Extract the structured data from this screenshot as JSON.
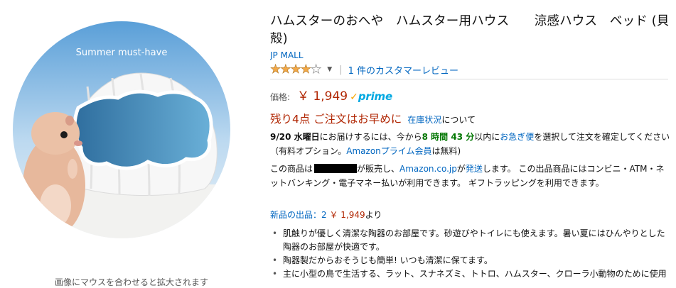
{
  "image": {
    "overlay_text": "Summer must-have",
    "hover_hint": "画像にマウスを合わせると拡大されます"
  },
  "product": {
    "title": "ハムスターのおへや　ハムスター用ハウス　　涼感ハウス　ベッド (貝殻)",
    "brand": "JP MALL",
    "rating": {
      "stars": 4,
      "max_stars": 5,
      "review_link": "1 件のカスタマーレビュー"
    },
    "price": {
      "label": "価格:",
      "amount": "￥ 1,949",
      "prime_check": "✓",
      "prime_text": "prime"
    },
    "stock": {
      "warning": "残り4点 ご注文はお早めに",
      "link": "在庫状況",
      "after": "について"
    },
    "delivery": {
      "date": "9/20 水曜日",
      "text1": "にお届けするには、今から",
      "countdown": "8 時間 43 分",
      "text2": "以内に",
      "express_link": "お急ぎ便",
      "text3": "を選択して注文を確定してください（有料オプション。",
      "prime_member_link": "Amazonプライム会員",
      "text4": "は無料)"
    },
    "seller": {
      "text1": "この商品は",
      "text2": "が販売し、",
      "amazon_link": "Amazon.co.jp",
      "text3": "が",
      "shipping_link": "発送",
      "text4": "します。 この出品商品にはコンビニ・ATM・ネットバンキング・電子マネー払いが利用できます。 ギフトラッピングを利用できます。"
    },
    "new_offers": {
      "link": "新品の出品：2",
      "price": "￥ 1,949",
      "suffix": "より"
    },
    "bullets": [
      "肌触りが優しく清潔な陶器のお部屋です。砂遊びやトイレにも使えます。暑い夏にはひんやりとした陶器のお部屋が快適です。",
      "陶器製だからおそうじも簡単! いつも清潔に保てます。",
      "主に小型の鳥で生活する、ラット、スナネズミ、トトロ、ハムスター、クローラ小動物のために使用"
    ]
  },
  "colors": {
    "price_red": "#b12704",
    "link_blue": "#0066c0",
    "urgent_green": "#007600",
    "prime_blue": "#00a8e1",
    "star_orange": "#f3a847"
  }
}
